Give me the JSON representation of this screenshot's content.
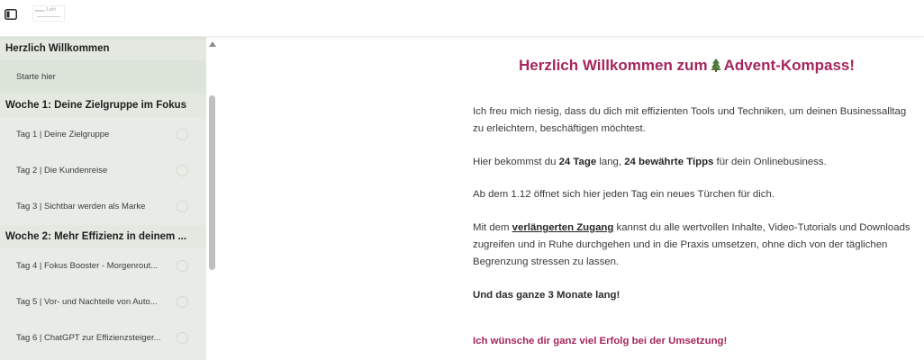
{
  "header": {
    "logo": {
      "text": "jessica",
      "script": "Lubi"
    }
  },
  "sidebar": {
    "sections": [
      {
        "title": "Herzlich Willkommen",
        "items": [
          {
            "label": "Starte hier",
            "active": true
          }
        ]
      },
      {
        "title": "Woche 1: Deine Zielgruppe im Fokus",
        "items": [
          {
            "label": "Tag 1 | Deine Zielgruppe"
          },
          {
            "label": "Tag 2 | Die Kundenreise"
          },
          {
            "label": "Tag 3 | Sichtbar werden als Marke"
          }
        ]
      },
      {
        "title": "Woche 2: Mehr Effizienz in deinem ...",
        "items": [
          {
            "label": "Tag 4 | Fokus Booster - Morgenrout..."
          },
          {
            "label": "Tag 5 | Vor- und Nachteile von Auto..."
          },
          {
            "label": "Tag 6 | ChatGPT zur Effizienzsteiger..."
          }
        ]
      }
    ]
  },
  "main": {
    "title_before": "Herzlich Willkommen zum",
    "title_after": "Advent-Kompass!",
    "p1": "Ich freu mich riesig, dass du dich mit effizienten Tools und Techniken, um deinen Businessalltag zu erleichtern, beschäftigen möchtest.",
    "p2": {
      "a": "Hier bekommst du ",
      "b": "24 Tage",
      "c": " lang, ",
      "d": "24 bewährte Tipps",
      "e": " für dein Onlinebusiness."
    },
    "p3": "Ab dem 1.12 öffnet sich hier jeden Tag ein neues Türchen für dich.",
    "p4": {
      "a": "Mit dem ",
      "link": "verlängerten Zugang",
      "b": " kannst du alle wertvollen Inhalte, Video-Tutorials und Downloads zugreifen und in Ruhe durchgehen und in die Praxis umsetzen, ohne dich von der täglichen Begrenzung stressen zu lassen."
    },
    "p5": "Und das ganze 3 Monate lang!",
    "p6": "Ich wünsche dir ganz viel Erfolg bei der Umsetzung!"
  },
  "colors": {
    "accent": "#a5265c",
    "sidebar_bg": "#e8ece6",
    "tree": "#3f7a3a"
  }
}
